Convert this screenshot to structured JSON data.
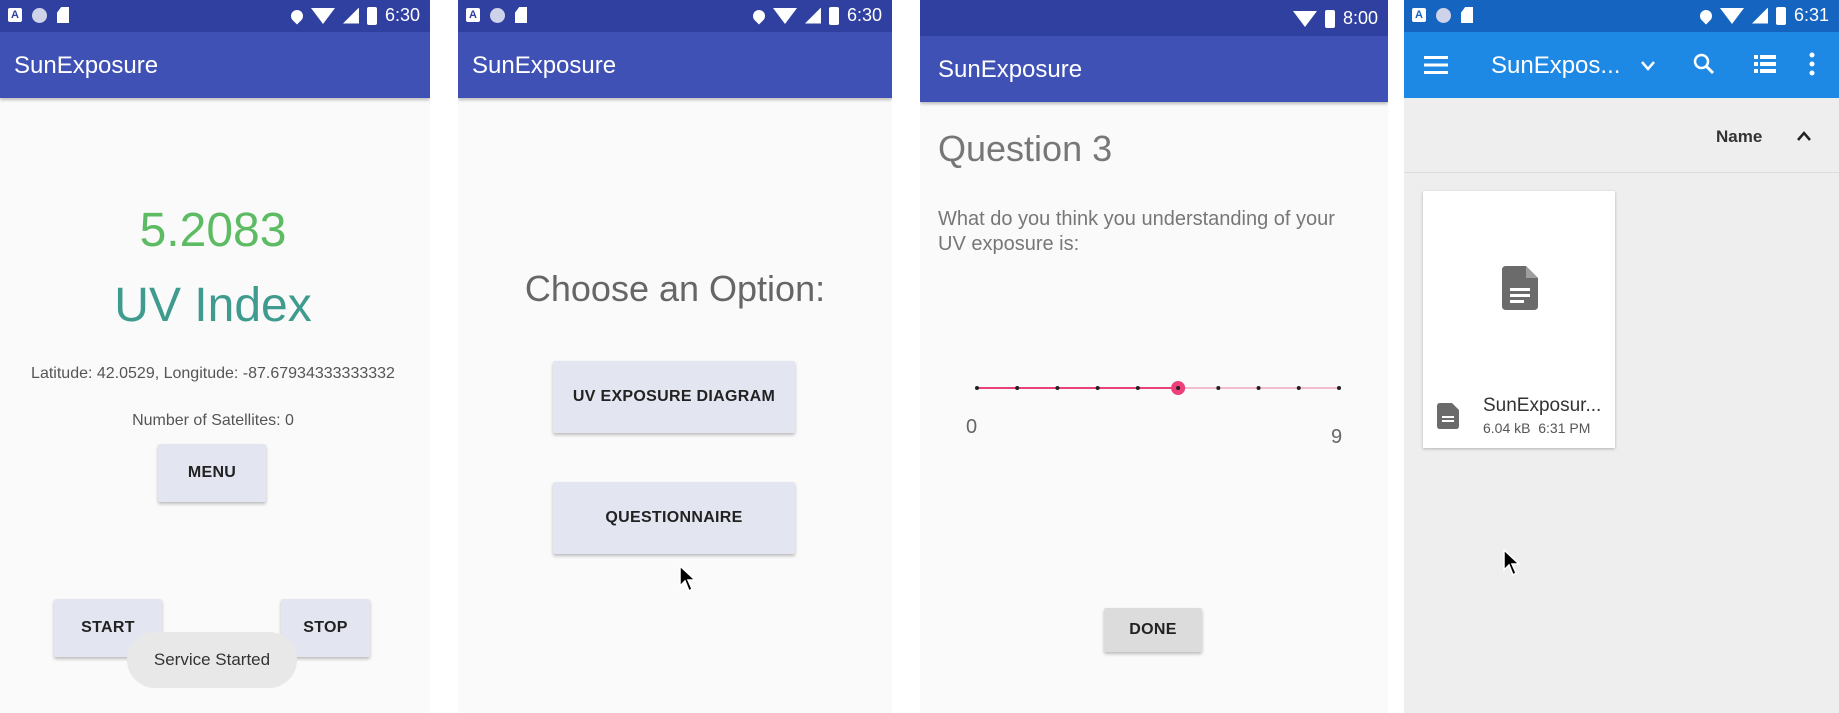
{
  "screens": [
    {
      "status_time": "6:30",
      "app_title": "SunExposure",
      "uv_value": "5.2083",
      "uv_label": "UV Index",
      "location": "Latitude: 42.0529, Longitude: -87.67934333333332",
      "satellites": "Number of Satellites: 0",
      "menu_label": "MENU",
      "start_label": "START",
      "stop_label": "STOP",
      "toast": "Service Started"
    },
    {
      "status_time": "6:30",
      "app_title": "SunExposure",
      "heading": "Choose an Option:",
      "diagram_label": "UV EXPOSURE DIAGRAM",
      "questionnaire_label": "QUESTIONNAIRE"
    },
    {
      "status_time": "8:00",
      "app_title": "SunExposure",
      "question_title": "Question 3",
      "question_text": "What do you think you understanding of your UV exposure is:",
      "slider": {
        "min": "0",
        "max": "9",
        "value": 5
      },
      "done_label": "DONE"
    },
    {
      "status_time": "6:31",
      "folder_title": "SunExpos...",
      "sort_label": "Name",
      "file_name": "SunExposur...",
      "file_meta": "6.04 kB  6:31 PM"
    }
  ],
  "colors": {
    "appbar": "#3f51b5",
    "statusbar": "#3040a0",
    "uv_value": "#5dbb63",
    "uv_label": "#3f9b8e",
    "slider_accent": "#ec407a"
  },
  "icons": [
    "menu-icon",
    "dropdown-icon",
    "search-icon",
    "list-view-icon",
    "more-vert-icon",
    "document-icon",
    "sort-up-icon",
    "mouse-cursor-icon"
  ]
}
